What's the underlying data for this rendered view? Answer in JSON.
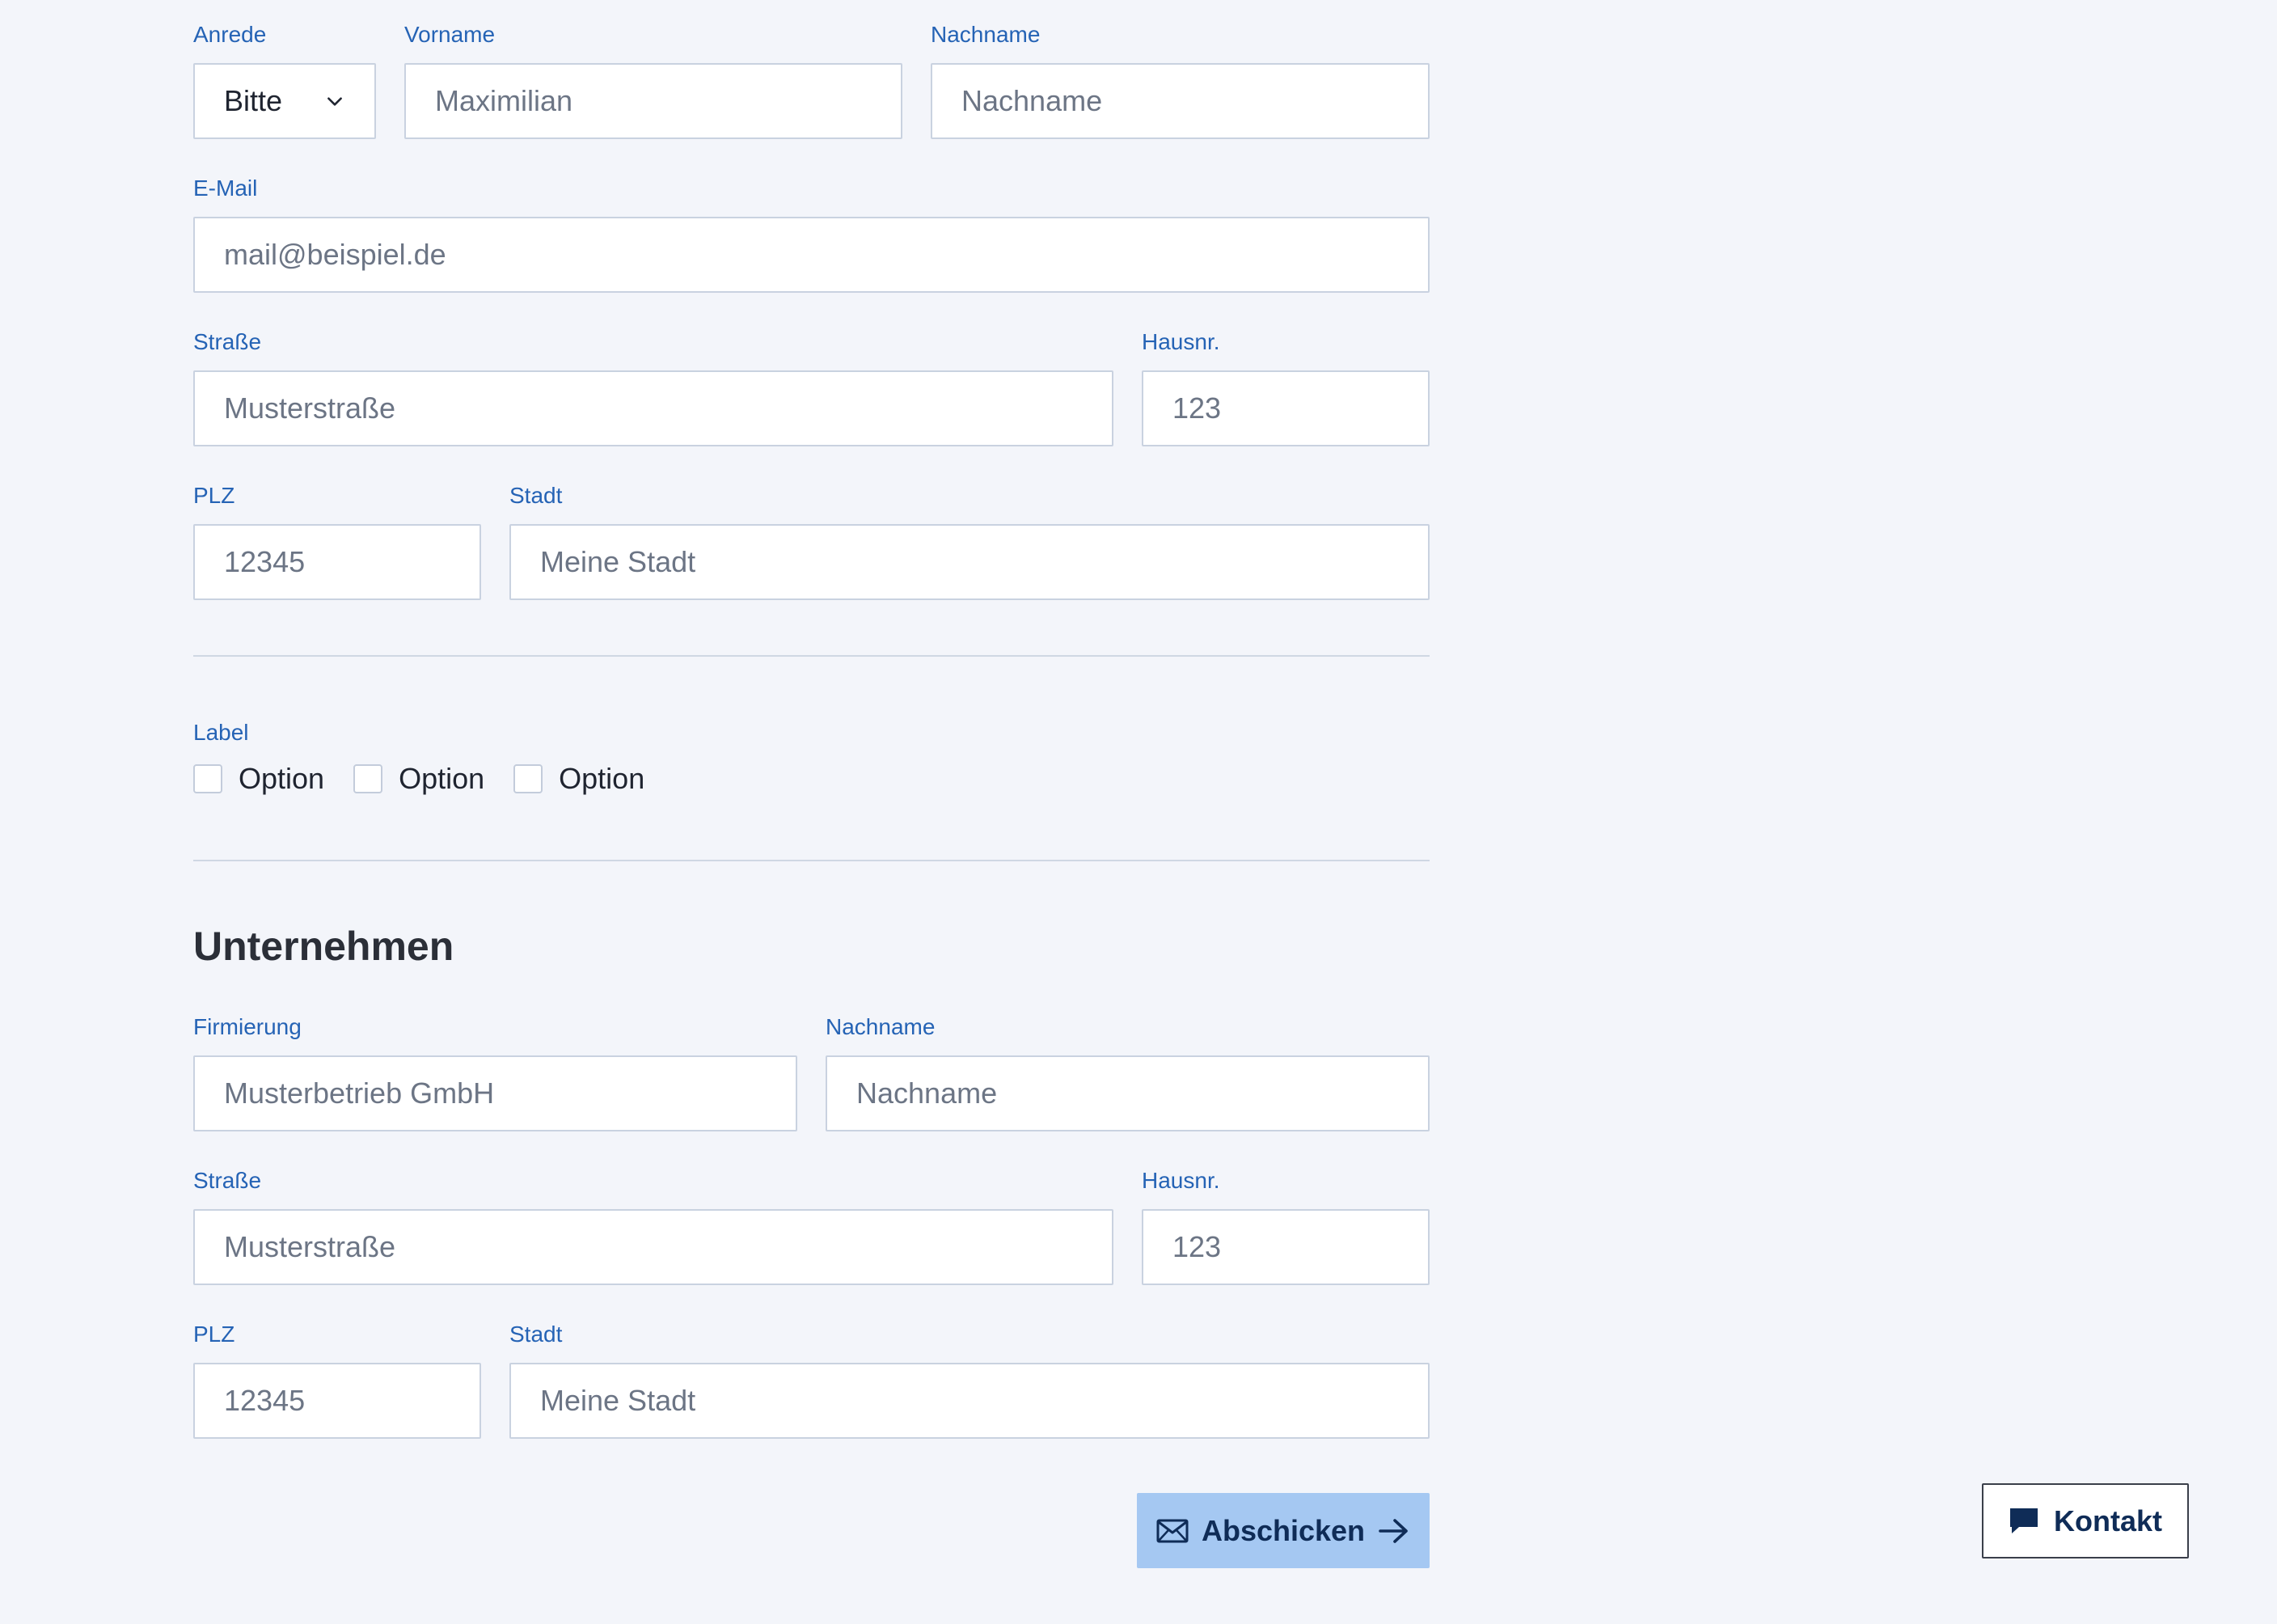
{
  "personal": {
    "salutation": {
      "label": "Anrede",
      "value": "Bitte"
    },
    "first_name": {
      "label": "Vorname",
      "placeholder": "Maximilian"
    },
    "last_name": {
      "label": "Nachname",
      "placeholder": "Nachname"
    },
    "email": {
      "label": "E-Mail",
      "placeholder": "mail@beispiel.de"
    },
    "street": {
      "label": "Straße",
      "placeholder": "Musterstraße"
    },
    "house_number": {
      "label": "Hausnr.",
      "placeholder": "123"
    },
    "zip": {
      "label": "PLZ",
      "placeholder": "12345"
    },
    "city": {
      "label": "Stadt",
      "placeholder": "Meine Stadt"
    }
  },
  "options": {
    "label": "Label",
    "items": [
      {
        "label": "Option",
        "checked": false
      },
      {
        "label": "Option",
        "checked": false
      },
      {
        "label": "Option",
        "checked": false
      }
    ]
  },
  "company": {
    "title": "Unternehmen",
    "firm": {
      "label": "Firmierung",
      "placeholder": "Musterbetrieb GmbH"
    },
    "last_name": {
      "label": "Nachname",
      "placeholder": "Nachname"
    },
    "street": {
      "label": "Straße",
      "placeholder": "Musterstraße"
    },
    "house_number": {
      "label": "Hausnr.",
      "placeholder": "123"
    },
    "zip": {
      "label": "PLZ",
      "placeholder": "12345"
    },
    "city": {
      "label": "Stadt",
      "placeholder": "Meine Stadt"
    }
  },
  "actions": {
    "submit_label": "Abschicken",
    "submit_icon": "mail-icon",
    "submit_trailing_icon": "arrow-right-icon",
    "contact_label": "Kontakt",
    "contact_icon": "chat-bubble-icon"
  },
  "colors": {
    "background": "#f3f5fa",
    "label_blue": "#2563b5",
    "submit_bg": "#a5c8f2",
    "button_text": "#0f2c57"
  }
}
